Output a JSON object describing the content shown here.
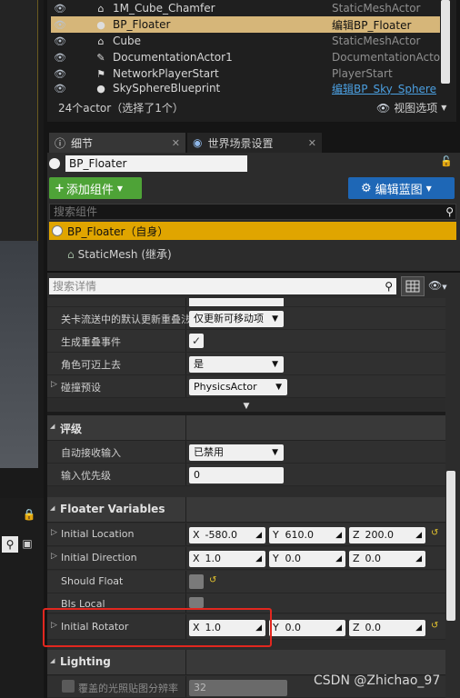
{
  "outliner": {
    "rows": [
      {
        "name": "1M_Cube_Chamfer",
        "type": "StaticMeshActor",
        "type_style": "plain",
        "icon": "cube-icon"
      },
      {
        "name": "BP_Floater",
        "type": "编辑BP_Floater",
        "type_style": "edit",
        "icon": "sphere-icon",
        "selected": true
      },
      {
        "name": "Cube",
        "type": "StaticMeshActor",
        "type_style": "plain",
        "icon": "cube-icon"
      },
      {
        "name": "DocumentationActor1",
        "type": "DocumentationActor",
        "type_style": "plain",
        "icon": "doc-icon"
      },
      {
        "name": "NetworkPlayerStart",
        "type": "PlayerStart",
        "type_style": "plain",
        "icon": "player-start-icon"
      },
      {
        "name": "SkySphereBlueprint",
        "type": "编辑BP_Sky_Sphere",
        "type_style": "link",
        "icon": "sphere-icon"
      }
    ],
    "footer": "24个actor（选择了1个）",
    "view_options": "视图选项"
  },
  "tabs": {
    "details": "细节",
    "world_settings": "世界场景设置"
  },
  "details": {
    "actor_name": "BP_Floater",
    "add_component": "添加组件",
    "edit_blueprint": "编辑蓝图",
    "component_search_placeholder": "搜索组件",
    "self_component": "BP_Floater（自身）",
    "child_component": "StaticMesh (继承)",
    "detail_search_placeholder": "搜索详情"
  },
  "props_top": [
    {
      "label": "关卡流送中的默认更新重叠法",
      "value": "仅更新可移动项",
      "kind": "combo"
    },
    {
      "label": "生成重叠事件",
      "value": "✓",
      "kind": "check"
    },
    {
      "label": "角色可迈上去",
      "value": "是",
      "kind": "combo"
    },
    {
      "label": "碰撞预设",
      "value": "PhysicsActor",
      "kind": "combo"
    }
  ],
  "section_input": {
    "title": "评级",
    "rows": [
      {
        "label": "自动接收输入",
        "value": "已禁用"
      },
      {
        "label": "输入优先级",
        "value": "0"
      }
    ]
  },
  "section_floater": {
    "title": "Floater Variables",
    "initial_location": {
      "label": "Initial Location",
      "x": "-580.0",
      "y": "610.0",
      "z": "200.0"
    },
    "initial_direction": {
      "label": "Initial Direction",
      "x": "1.0",
      "y": "0.0",
      "z": "0.0"
    },
    "should_float": {
      "label": "Should Float"
    },
    "bis_local": {
      "label": "BIs Local"
    },
    "initial_rotator": {
      "label": "Initial Rotator",
      "x": "1.0",
      "y": "0.0",
      "z": "0.0"
    }
  },
  "section_lighting": {
    "title": "Lighting",
    "row": {
      "label": "覆盖的光照贴图分辨率",
      "value": "32"
    }
  },
  "axis_labels": {
    "x": "X",
    "y": "Y",
    "z": "Z"
  },
  "watermark": "CSDN @Zhichao_97",
  "colors": {
    "selection": "#d6b679",
    "add_button": "#4ea337",
    "blueprint_button": "#1e67b6",
    "self_component": "#e0a500",
    "highlight_box": "#e2271f"
  }
}
